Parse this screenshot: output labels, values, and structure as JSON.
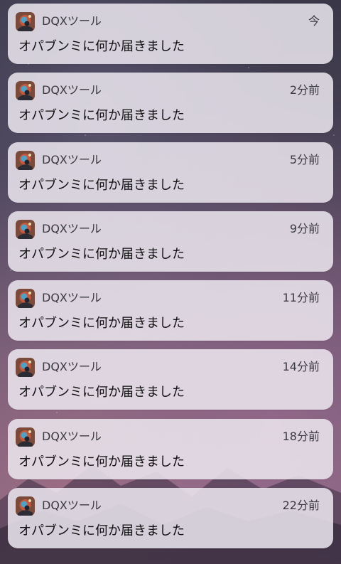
{
  "notifications": [
    {
      "app_name": "DQXツール",
      "time": "今",
      "message": "オパブンミに何か届きました",
      "icon": "dqx-tool-app-icon"
    },
    {
      "app_name": "DQXツール",
      "time": "2分前",
      "message": "オパブンミに何か届きました",
      "icon": "dqx-tool-app-icon"
    },
    {
      "app_name": "DQXツール",
      "time": "5分前",
      "message": "オパブンミに何か届きました",
      "icon": "dqx-tool-app-icon"
    },
    {
      "app_name": "DQXツール",
      "time": "9分前",
      "message": "オパブンミに何か届きました",
      "icon": "dqx-tool-app-icon"
    },
    {
      "app_name": "DQXツール",
      "time": "11分前",
      "message": "オパブンミに何か届きました",
      "icon": "dqx-tool-app-icon"
    },
    {
      "app_name": "DQXツール",
      "time": "14分前",
      "message": "オパブンミに何か届きました",
      "icon": "dqx-tool-app-icon"
    },
    {
      "app_name": "DQXツール",
      "time": "18分前",
      "message": "オパブンミに何か届きました",
      "icon": "dqx-tool-app-icon"
    },
    {
      "app_name": "DQXツール",
      "time": "22分前",
      "message": "オパブンミに何か届きました",
      "icon": "dqx-tool-app-icon"
    }
  ]
}
